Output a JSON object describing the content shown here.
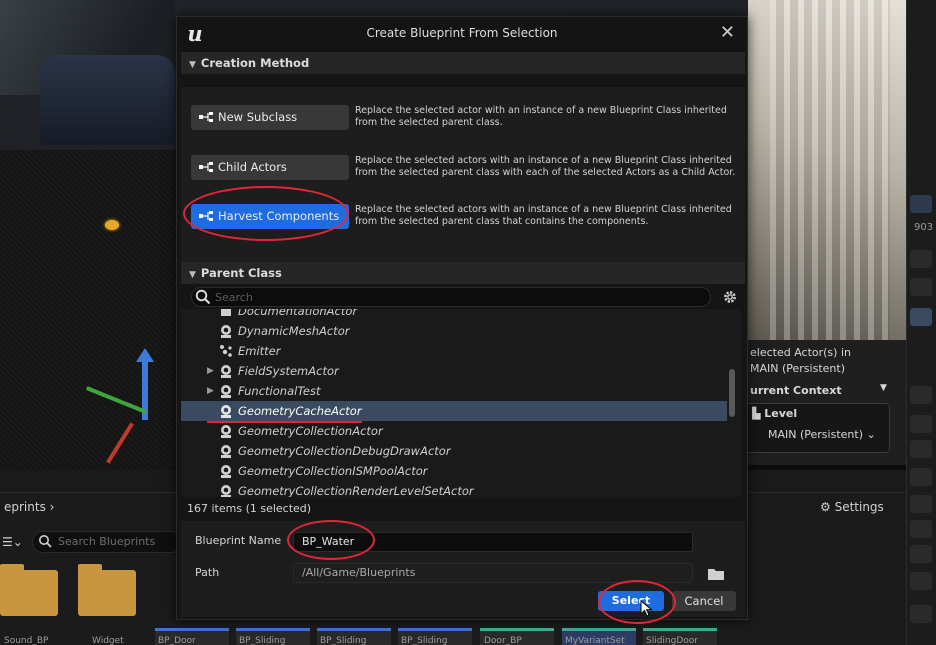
{
  "dialog": {
    "title": "Create Blueprint From Selection",
    "close_glyph": "✕",
    "logo_glyph": "u"
  },
  "creation_method": {
    "header": "Creation Method",
    "options": [
      {
        "label": "New Subclass",
        "description": "Replace the selected actor with an instance of a new Blueprint Class inherited from the selected parent class."
      },
      {
        "label": "Child Actors",
        "description": "Replace the selected actors with an instance of a new Blueprint Class inherited from the selected parent class with each of the selected Actors as a Child Actor."
      },
      {
        "label": "Harvest Components",
        "description": "Replace the selected actors with an instance of a new Blueprint Class inherited from the selected parent class that contains the components.",
        "active": true
      }
    ]
  },
  "parent_class": {
    "header": "Parent Class",
    "search_placeholder": "Search",
    "items": [
      {
        "label": "DocumentationActor",
        "icon": "documentation-icon"
      },
      {
        "label": "DynamicMeshActor",
        "icon": "actor-icon"
      },
      {
        "label": "Emitter",
        "icon": "emitter-icon"
      },
      {
        "label": "FieldSystemActor",
        "icon": "actor-icon",
        "expandable": true
      },
      {
        "label": "FunctionalTest",
        "icon": "actor-icon",
        "expandable": true
      },
      {
        "label": "GeometryCacheActor",
        "icon": "actor-icon",
        "selected": true
      },
      {
        "label": "GeometryCollectionActor",
        "icon": "actor-icon"
      },
      {
        "label": "GeometryCollectionDebugDrawActor",
        "icon": "actor-icon"
      },
      {
        "label": "GeometryCollectionISMPoolActor",
        "icon": "actor-icon"
      },
      {
        "label": "GeometryCollectionRenderLevelSetActor",
        "icon": "actor-icon"
      }
    ],
    "count_text": "167 items (1 selected)"
  },
  "fields": {
    "blueprint_name_label": "Blueprint Name",
    "blueprint_name_value": "BP_Water",
    "path_label": "Path",
    "path_value": "/All/Game/Blueprints"
  },
  "buttons": {
    "select": "Select",
    "cancel": "Cancel"
  },
  "editor": {
    "right_panel": {
      "selected_text_1": "elected Actor(s) in",
      "selected_text_2": "MAIN (Persistent)",
      "context_text": "urrent Context",
      "level_label": "Level",
      "level_value": "MAIN (Persistent) ⌄",
      "number": "903"
    },
    "content_browser": {
      "path": "eprints",
      "search_placeholder": "Search Blueprints",
      "settings": "Settings",
      "assets": [
        "Sound_BP",
        "Widget",
        "BP_Door",
        "BP_Sliding",
        "BP_Sliding",
        "BP_Sliding",
        "Door_BP",
        "MyVariantSet",
        "SlidingDoor"
      ]
    }
  },
  "colors": {
    "accent": "#1f6be0",
    "annotation": "#e0263a",
    "selected_row": "#3a4a60"
  }
}
